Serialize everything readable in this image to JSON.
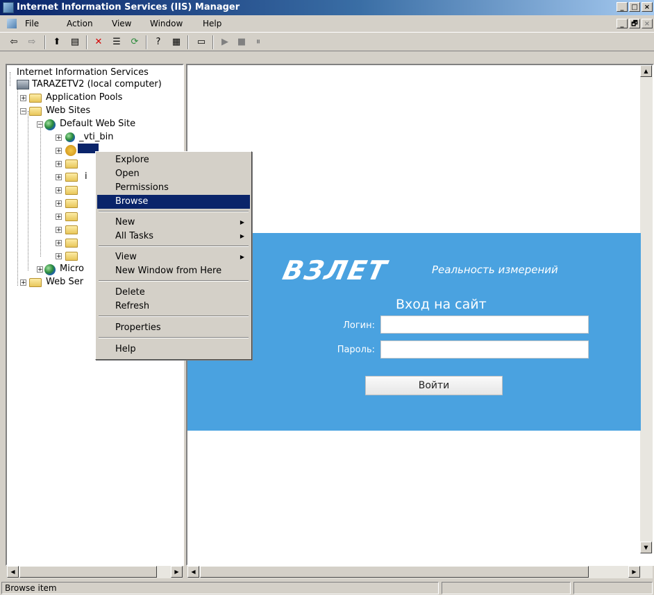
{
  "window": {
    "title": "Internet Information Services (IIS) Manager",
    "min": "_",
    "max": "□",
    "close": "×"
  },
  "menubar": {
    "items": [
      "File",
      "Action",
      "View",
      "Window",
      "Help"
    ],
    "mdi_min": "_",
    "mdi_restore": "🗗",
    "mdi_close": "×"
  },
  "toolbar": {
    "back": "⇦",
    "forward": "⇨",
    "up": "⬆",
    "showhide": "▤",
    "delete": "✕",
    "properties": "☰",
    "refresh": "⟳",
    "help": "?",
    "console": "▦",
    "computer": "▭",
    "play": "▶",
    "stop": "■",
    "pause": "⏸"
  },
  "tree": {
    "root": "Internet Information Services",
    "computer": "TARAZETV2 (local computer)",
    "app_pools": "Application Pools",
    "web_sites": "Web Sites",
    "default_site": "Default Web Site",
    "vti_bin": "_vti_bin",
    "selected": "",
    "micro_partial": "Micro",
    "web_services_partial": "Web Ser",
    "partial_i": "i"
  },
  "context_menu": {
    "items": [
      "Explore",
      "Open",
      "Permissions",
      "Browse",
      "New",
      "All Tasks",
      "View",
      "New Window from Here",
      "Delete",
      "Refresh",
      "Properties",
      "Help"
    ],
    "selected_index": 3,
    "submenu_arrow": "▶"
  },
  "login_page": {
    "logo": "ВЗЛЕТ",
    "tagline": "Реальность измерений",
    "title": "Вход на сайт",
    "login_label": "Логин:",
    "password_label": "Пароль:",
    "login_value": "",
    "password_value": "",
    "submit": "Войти"
  },
  "statusbar": {
    "text": "Browse item"
  },
  "scroll": {
    "left": "◀",
    "right": "▶",
    "up": "▲",
    "down": "▼"
  }
}
